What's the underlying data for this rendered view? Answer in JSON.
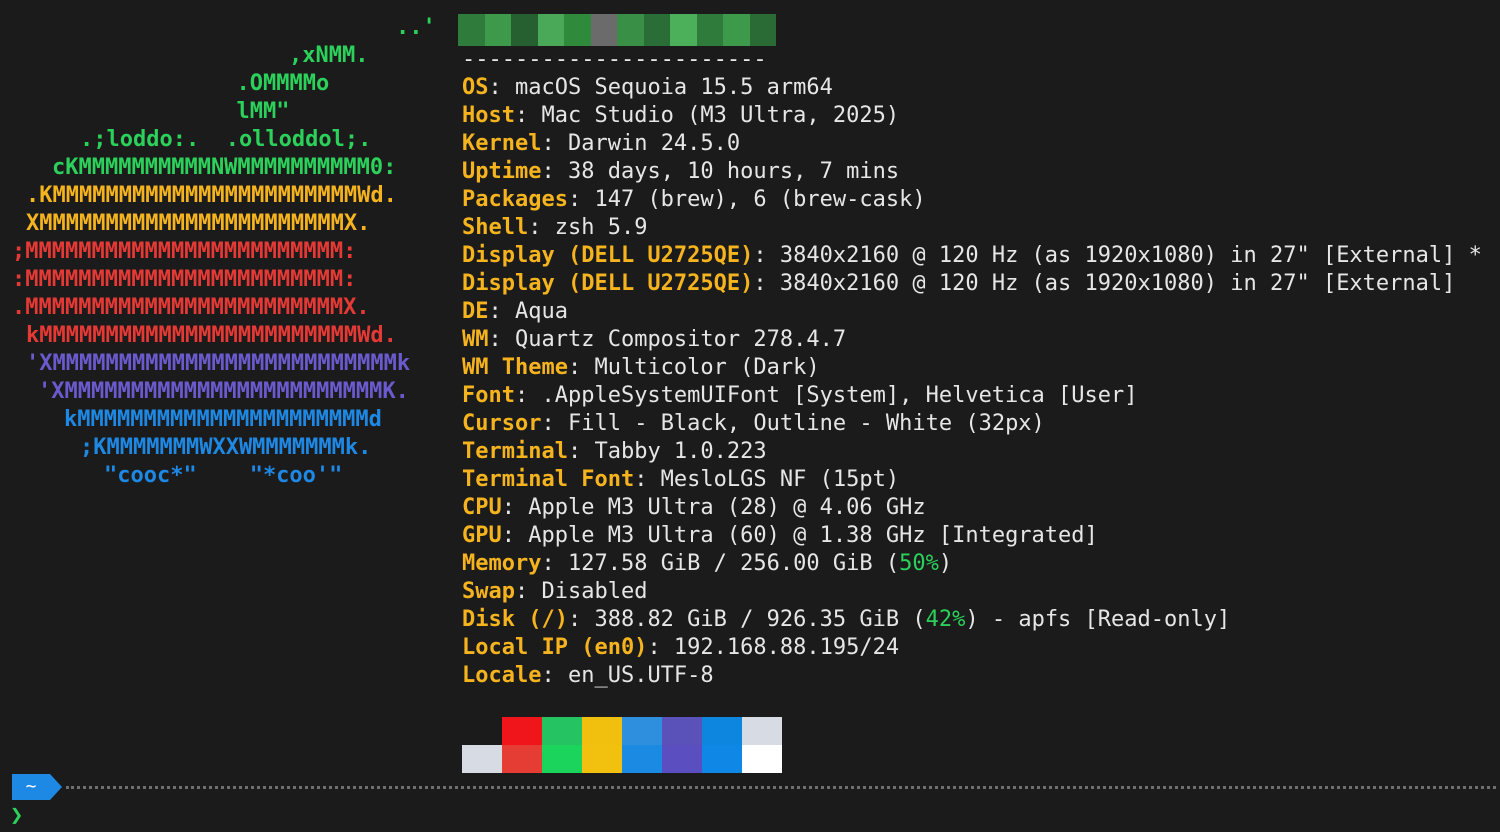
{
  "logo": {
    "lines": [
      {
        "text": "        ..'",
        "color": "#2bd15a"
      },
      {
        "text": "    ,xNMM.",
        "color": "#2bd15a"
      },
      {
        "text": "  .OMMMMo",
        "color": "#2bd15a"
      },
      {
        "text": "  lMM\"",
        "color": "#2bd15a"
      },
      {
        "text": ".;loddo:.  .olloddol;.",
        "color": "#2bd15a"
      },
      {
        "text": "cKMMMMMMMMMMNWMMMMMMMMMM0:",
        "color": "#2bd15a"
      },
      {
        "text": ".KMMMMMMMMMMMMMMMMMMMMMMMWd.",
        "color": "#f5b31e"
      },
      {
        "text": "XMMMMMMMMMMMMMMMMMMMMMMMX.",
        "color": "#f5b31e"
      },
      {
        "text": ";MMMMMMMMMMMMMMMMMMMMMMMM:",
        "color": "#e53935"
      },
      {
        "text": ":MMMMMMMMMMMMMMMMMMMMMMMM:",
        "color": "#e53935"
      },
      {
        "text": ".MMMMMMMMMMMMMMMMMMMMMMMMX.",
        "color": "#e53935"
      },
      {
        "text": "kMMMMMMMMMMMMMMMMMMMMMMMMWd.",
        "color": "#e53935"
      },
      {
        "text": "'XMMMMMMMMMMMMMMMMMMMMMMMMMMk",
        "color": "#6a5acd"
      },
      {
        "text": "'XMMMMMMMMMMMMMMMMMMMMMMMMK.",
        "color": "#6a5acd"
      },
      {
        "text": "kMMMMMMMMMMMMMMMMMMMMMMd",
        "color": "#1e88e5"
      },
      {
        "text": ";KMMMMMMMWXXWMMMMMMMk.",
        "color": "#1e88e5"
      },
      {
        "text": "\"cooc*\"    \"*coo'\"",
        "color": "#1e88e5"
      }
    ]
  },
  "separator": "-----------------------",
  "info": [
    {
      "key": "OS",
      "value": ": macOS Sequoia 15.5 arm64"
    },
    {
      "key": "Host",
      "value": ": Mac Studio (M3 Ultra, 2025)"
    },
    {
      "key": "Kernel",
      "value": ": Darwin 24.5.0"
    },
    {
      "key": "Uptime",
      "value": ": 38 days, 10 hours, 7 mins"
    },
    {
      "key": "Packages",
      "value": ": 147 (brew), 6 (brew-cask)"
    },
    {
      "key": "Shell",
      "value": ": zsh 5.9"
    },
    {
      "key": "Display (DELL U2725QE)",
      "value": ": 3840x2160 @ 120 Hz (as 1920x1080) in 27\" [External] *"
    },
    {
      "key": "Display (DELL U2725QE)",
      "value": ": 3840x2160 @ 120 Hz (as 1920x1080) in 27\" [External]"
    },
    {
      "key": "DE",
      "value": ": Aqua"
    },
    {
      "key": "WM",
      "value": ": Quartz Compositor 278.4.7"
    },
    {
      "key": "WM Theme",
      "value": ": Multicolor (Dark)"
    },
    {
      "key": "Font",
      "value": ": .AppleSystemUIFont [System], Helvetica [User]"
    },
    {
      "key": "Cursor",
      "value": ": Fill - Black, Outline - White (32px)"
    },
    {
      "key": "Terminal",
      "value": ": Tabby 1.0.223"
    },
    {
      "key": "Terminal Font",
      "value": ": MesloLGS NF (15pt)"
    },
    {
      "key": "CPU",
      "value": ": Apple M3 Ultra (28) @ 4.06 GHz"
    },
    {
      "key": "GPU",
      "value": ": Apple M3 Ultra (60) @ 1.38 GHz [Integrated]"
    },
    {
      "key": "Memory",
      "value": ": 127.58 GiB / 256.00 GiB (",
      "pct": "50%",
      "tail": ")"
    },
    {
      "key": "Swap",
      "value": ": Disabled"
    },
    {
      "key": "Disk (/)",
      "value": ": 388.82 GiB / 926.35 GiB (",
      "pct": "42%",
      "tail": ") - apfs [Read-only]"
    },
    {
      "key": "Local IP (en0)",
      "value": ": 192.168.88.195/24"
    },
    {
      "key": "Locale",
      "value": ": en_US.UTF-8"
    }
  ],
  "palette": {
    "top": [
      "#1b1b1b",
      "#f0151b",
      "#26c363",
      "#f1c00f",
      "#2d8fde",
      "#5a52b8",
      "#0d86e0",
      "#d6dbe4"
    ],
    "bottom": [
      "#d6dbe4",
      "#e53d34",
      "#1ad45c",
      "#f2c00f",
      "#1b8ae3",
      "#5b4ec0",
      "#0e87e6",
      "#ffffff"
    ]
  },
  "redacted_colors": [
    "#2f7b3c",
    "#3d9a4a",
    "#265f30",
    "#4aa958",
    "#2f8a3c",
    "#6b6b6b",
    "#3a8f46",
    "#2b6d36",
    "#4cb05a",
    "#2f7b3c",
    "#3d9a4a",
    "#2a6a34"
  ],
  "prompt": {
    "dir": "~",
    "caret": "❯",
    "accent": "#1e88e5",
    "caret_color": "#2bd15a"
  }
}
